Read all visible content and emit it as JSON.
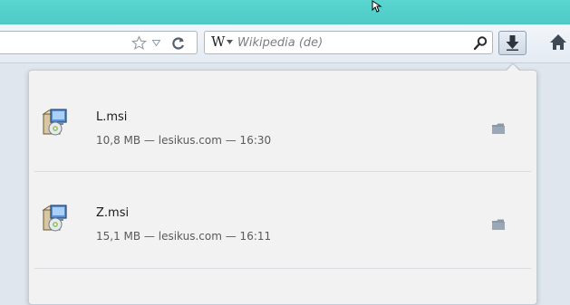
{
  "toolbar": {
    "search_engine_letter": "W",
    "search_placeholder": "Wikipedia (de)",
    "icons": [
      "star-icon",
      "dropmarker-icon",
      "reload-icon",
      "magnifier-icon",
      "download-arrow-icon",
      "home-icon"
    ]
  },
  "downloads": {
    "items": [
      {
        "name": "L.msi",
        "size": "10,8 MB",
        "source": "lesikus.com",
        "time": "16:30",
        "status": "10,8 MB — lesikus.com — 16:30"
      },
      {
        "name": "Z.msi",
        "size": "15,1 MB",
        "source": "lesikus.com",
        "time": "16:11",
        "status": "15,1 MB — lesikus.com — 16:11"
      }
    ]
  },
  "colors": {
    "frame": "#4fcac6",
    "toolbar": "#e4ebf3",
    "panel": "#f2f2f2",
    "folder_icon": "#8a98a8"
  }
}
